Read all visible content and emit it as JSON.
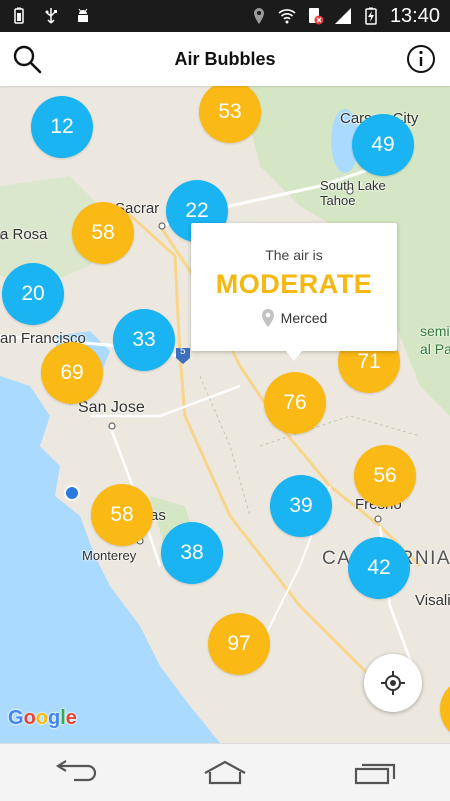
{
  "status_bar": {
    "time": "13:40",
    "icons_left": [
      "battery-full-icon",
      "usb-icon",
      "android-debug-icon"
    ],
    "icons_right": [
      "location-icon",
      "wifi-icon",
      "sim-error-icon",
      "signal-icon",
      "battery-charging-icon"
    ]
  },
  "app_bar": {
    "title": "Air Bubbles",
    "left_icon": "search-icon",
    "right_icon": "info-icon"
  },
  "map": {
    "places": {
      "carson_city": "Carson City",
      "south_lake_tahoe": "South Lake\nTahoe",
      "sacramento": "Sacrar",
      "santa_rosa": "a Rosa",
      "san_francisco": "an Francisco",
      "san_jose": "San Jose",
      "monterey": "Monterey",
      "fresno": "Fresno",
      "california": "CALIFORNIA",
      "visalia": "Visalia",
      "park": "semite\nal Park",
      "salinas": "as",
      "highway": "5"
    },
    "bubbles": [
      {
        "value": "12",
        "level": "good",
        "color": "#1ab4f2"
      },
      {
        "value": "53",
        "level": "moderate",
        "color": "#fbb916"
      },
      {
        "value": "49",
        "level": "good",
        "color": "#1ab4f2"
      },
      {
        "value": "22",
        "level": "good",
        "color": "#1ab4f2"
      },
      {
        "value": "58",
        "level": "moderate",
        "color": "#fbb916"
      },
      {
        "value": "20",
        "level": "good",
        "color": "#1ab4f2"
      },
      {
        "value": "33",
        "level": "good",
        "color": "#1ab4f2"
      },
      {
        "value": "69",
        "level": "moderate",
        "color": "#fbb916"
      },
      {
        "value": "71",
        "level": "moderate",
        "color": "#fbb916"
      },
      {
        "value": "76",
        "level": "moderate",
        "color": "#fbb916"
      },
      {
        "value": "56",
        "level": "moderate",
        "color": "#fbb916"
      },
      {
        "value": "39",
        "level": "good",
        "color": "#1ab4f2"
      },
      {
        "value": "58",
        "level": "moderate",
        "color": "#fbb916"
      },
      {
        "value": "38",
        "level": "good",
        "color": "#1ab4f2"
      },
      {
        "value": "42",
        "level": "good",
        "color": "#1ab4f2"
      },
      {
        "value": "97",
        "level": "moderate",
        "color": "#fbb916"
      }
    ],
    "tooltip": {
      "prefix": "The air is",
      "level": "MODERATE",
      "location": "Merced",
      "level_color": "#f6b80e"
    },
    "attribution": "Google",
    "locate_icon": "my-location-icon"
  },
  "nav_bar": {
    "back_icon": "back-icon",
    "home_icon": "home-icon",
    "recents_icon": "recent-apps-icon"
  }
}
